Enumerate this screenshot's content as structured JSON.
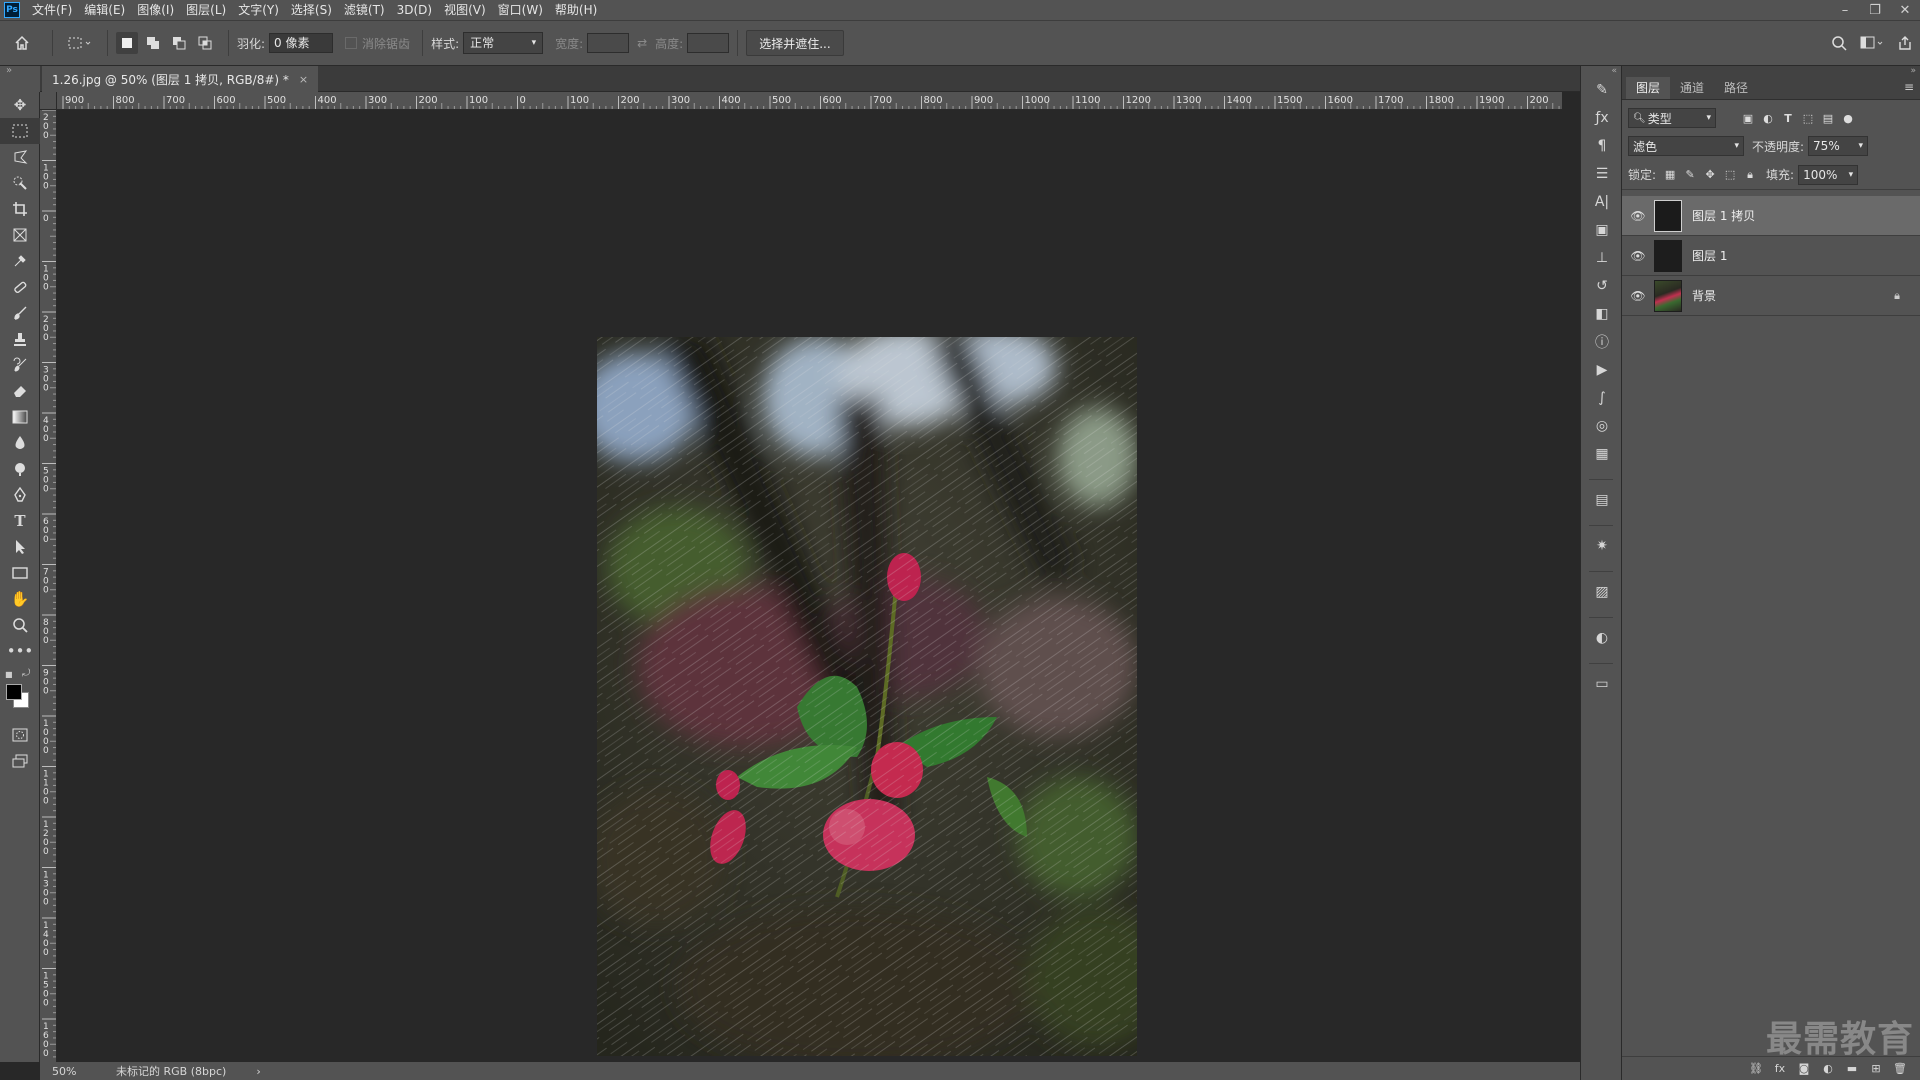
{
  "app": {
    "logo": "Ps"
  },
  "menu": [
    "文件(F)",
    "编辑(E)",
    "图像(I)",
    "图层(L)",
    "文字(Y)",
    "选择(S)",
    "滤镜(T)",
    "3D(D)",
    "视图(V)",
    "窗口(W)",
    "帮助(H)"
  ],
  "window_controls": [
    "minimize-icon",
    "restore-icon",
    "close-icon"
  ],
  "options": {
    "feather_label": "羽化:",
    "feather_value": "0 像素",
    "antialias_label": "消除锯齿",
    "style_label": "样式:",
    "style_value": "正常",
    "width_label": "宽度:",
    "height_label": "高度:",
    "select_mask_button": "选择并遮住..."
  },
  "document": {
    "tab_title": "1.26.jpg @ 50% (图层 1 拷贝, RGB/8#) *",
    "close": "×",
    "zoom": "50%",
    "color_profile": "未标记的 RGB (8bpc)",
    "status_arrow": "›"
  },
  "ruler": {
    "h_labels": [
      "900",
      "800",
      "700",
      "600",
      "500",
      "400",
      "300",
      "200",
      "100",
      "0",
      "100",
      "200",
      "300",
      "400",
      "500",
      "600",
      "700",
      "800",
      "900",
      "1000",
      "1100",
      "1200",
      "1300",
      "1400",
      "1500",
      "1600",
      "1700",
      "1800",
      "1900",
      "200"
    ],
    "v_labels": [
      "200",
      "100",
      "0",
      "100",
      "200",
      "300",
      "400",
      "500",
      "600",
      "700",
      "800",
      "900",
      "1000",
      "1100",
      "1200",
      "1300",
      "1400",
      "1500",
      "1600"
    ]
  },
  "tools": [
    "move-icon",
    "marquee-icon",
    "lasso-icon",
    "quick-select-icon",
    "crop-icon",
    "frame-icon",
    "eyedropper-icon",
    "healing-icon",
    "brush-icon",
    "stamp-icon",
    "history-brush-icon",
    "eraser-icon",
    "gradient-icon",
    "blur-icon",
    "dodge-icon",
    "pen-icon",
    "type-icon",
    "path-select-icon",
    "rectangle-icon",
    "hand-icon",
    "zoom-icon",
    "more-icon"
  ],
  "layers_panel": {
    "tabs": [
      "图层",
      "通道",
      "路径"
    ],
    "filter_kind": "类型",
    "blend_mode": "滤色",
    "opacity_label": "不透明度:",
    "opacity_value": "75%",
    "lock_label": "锁定:",
    "fill_label": "填充:",
    "fill_value": "100%",
    "layers": [
      {
        "name": "图层 1 拷贝",
        "selected": true,
        "locked": false
      },
      {
        "name": "图层 1",
        "selected": false,
        "locked": false
      },
      {
        "name": "背景",
        "selected": false,
        "locked": true
      }
    ]
  },
  "watermark": "最需教育",
  "colors": {
    "ui_bg": "#535353",
    "canvas_bg": "#282828",
    "selected_layer": "#6a6a6a",
    "flower_pink": "#e0305a",
    "leaf_green": "#3f8a3a"
  }
}
